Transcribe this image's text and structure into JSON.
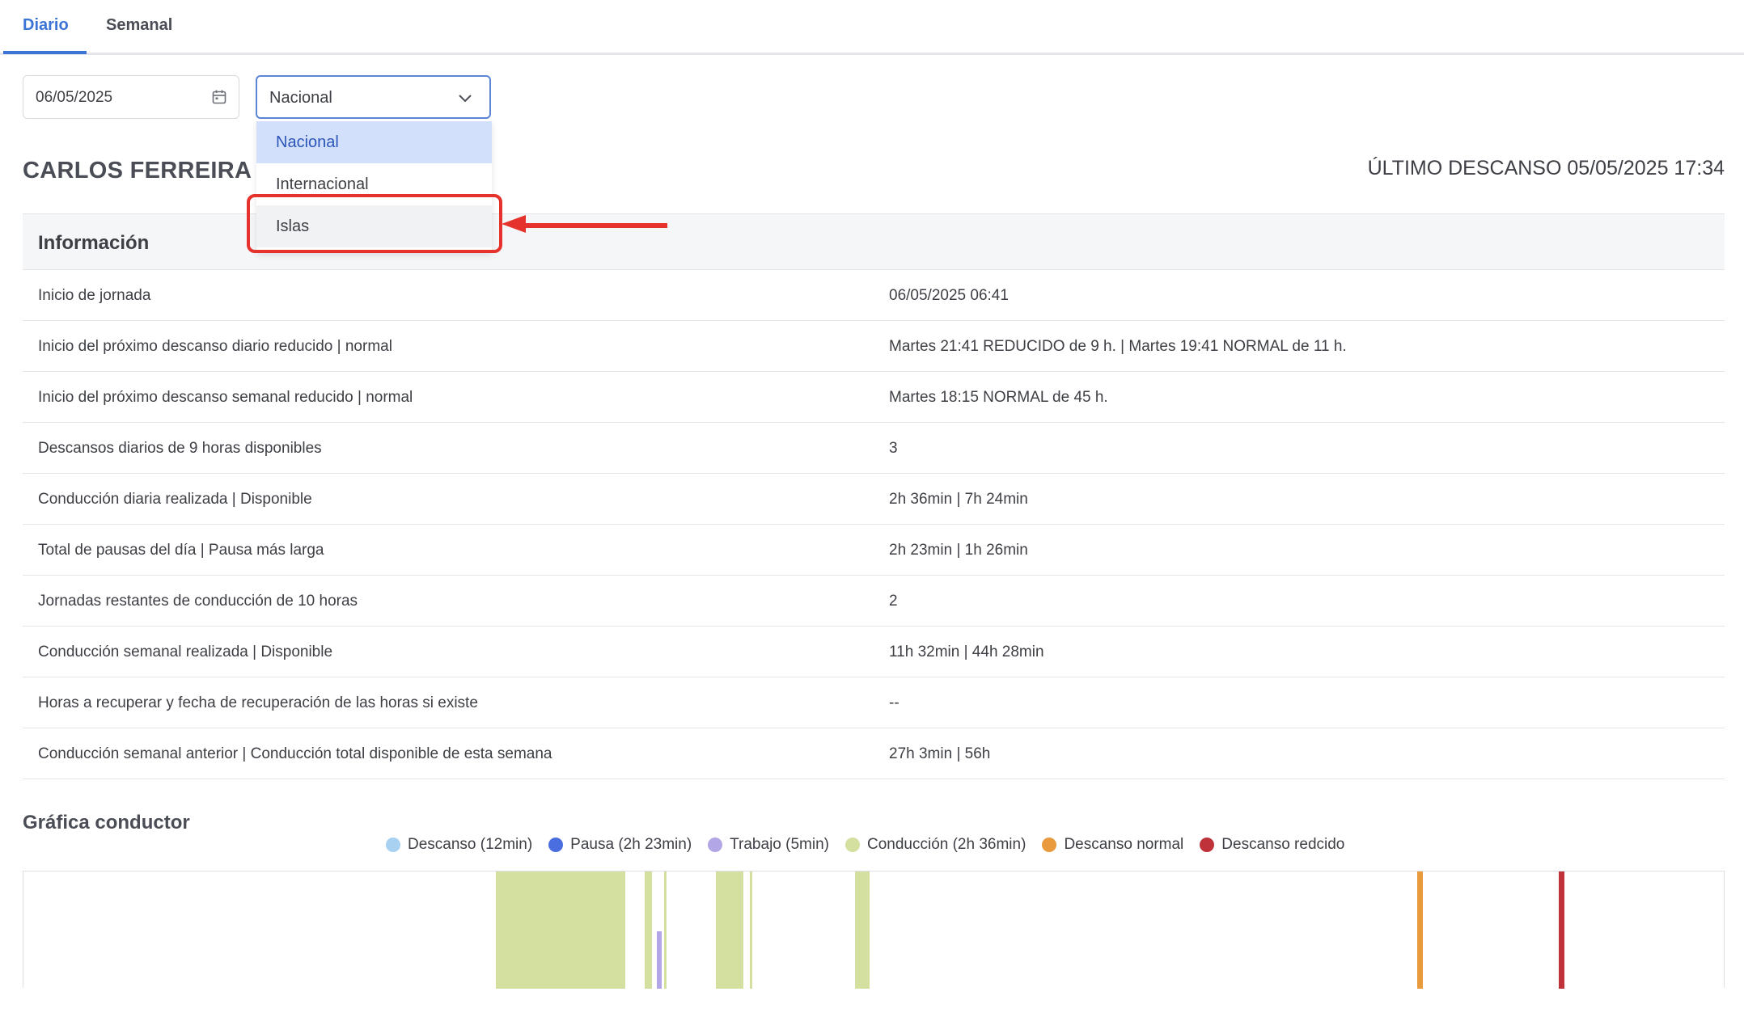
{
  "tabs": [
    {
      "label": "Diario",
      "active": true
    },
    {
      "label": "Semanal",
      "active": false
    }
  ],
  "date_field": {
    "value": "06/05/2025"
  },
  "region_select": {
    "value": "Nacional",
    "options": [
      "Nacional",
      "Internacional",
      "Islas"
    ],
    "selected": "Nacional",
    "hovered": "Islas"
  },
  "driver": {
    "name": "CARLOS FERREIRA E",
    "last_rest": "ÚLTIMO DESCANSO 05/05/2025 17:34"
  },
  "info": {
    "title": "Información",
    "rows": [
      {
        "label": "Inicio de jornada",
        "value": "06/05/2025 06:41"
      },
      {
        "label": "Inicio del próximo descanso diario reducido | normal",
        "value": "Martes 21:41 REDUCIDO de 9 h. | Martes 19:41 NORMAL de 11 h."
      },
      {
        "label": "Inicio del próximo descanso semanal reducido | normal",
        "value": "Martes 18:15 NORMAL de 45 h."
      },
      {
        "label": "Descansos diarios de 9 horas disponibles",
        "value": "3"
      },
      {
        "label": "Conducción diaria realizada | Disponible",
        "value": "2h 36min | 7h 24min"
      },
      {
        "label": "Total de pausas del día | Pausa más larga",
        "value": "2h 23min | 1h 26min"
      },
      {
        "label": "Jornadas restantes de conducción de 10 horas",
        "value": "2"
      },
      {
        "label": "Conducción semanal realizada | Disponible",
        "value": "11h 32min | 44h 28min"
      },
      {
        "label": "Horas a recuperar y fecha de recuperación de las horas si existe",
        "value": "--"
      },
      {
        "label": "Conducción semanal anterior | Conducción total disponible de esta semana",
        "value": "27h 3min | 56h"
      }
    ]
  },
  "chart": {
    "title": "Gráfica conductor",
    "legend": [
      {
        "label": "Descanso (12min)",
        "color": "#a8d0f0"
      },
      {
        "label": "Pausa (2h 23min)",
        "color": "#4a6ee0"
      },
      {
        "label": "Trabajo (5min)",
        "color": "#b3a6e6"
      },
      {
        "label": "Conducción (2h 36min)",
        "color": "#d4e0a0"
      },
      {
        "label": "Descanso normal",
        "color": "#e89a3c"
      },
      {
        "label": "Descanso redcido",
        "color": "#c0323a"
      }
    ]
  },
  "colors": {
    "accent": "#3b73d6",
    "annotation": "#e5322c"
  }
}
